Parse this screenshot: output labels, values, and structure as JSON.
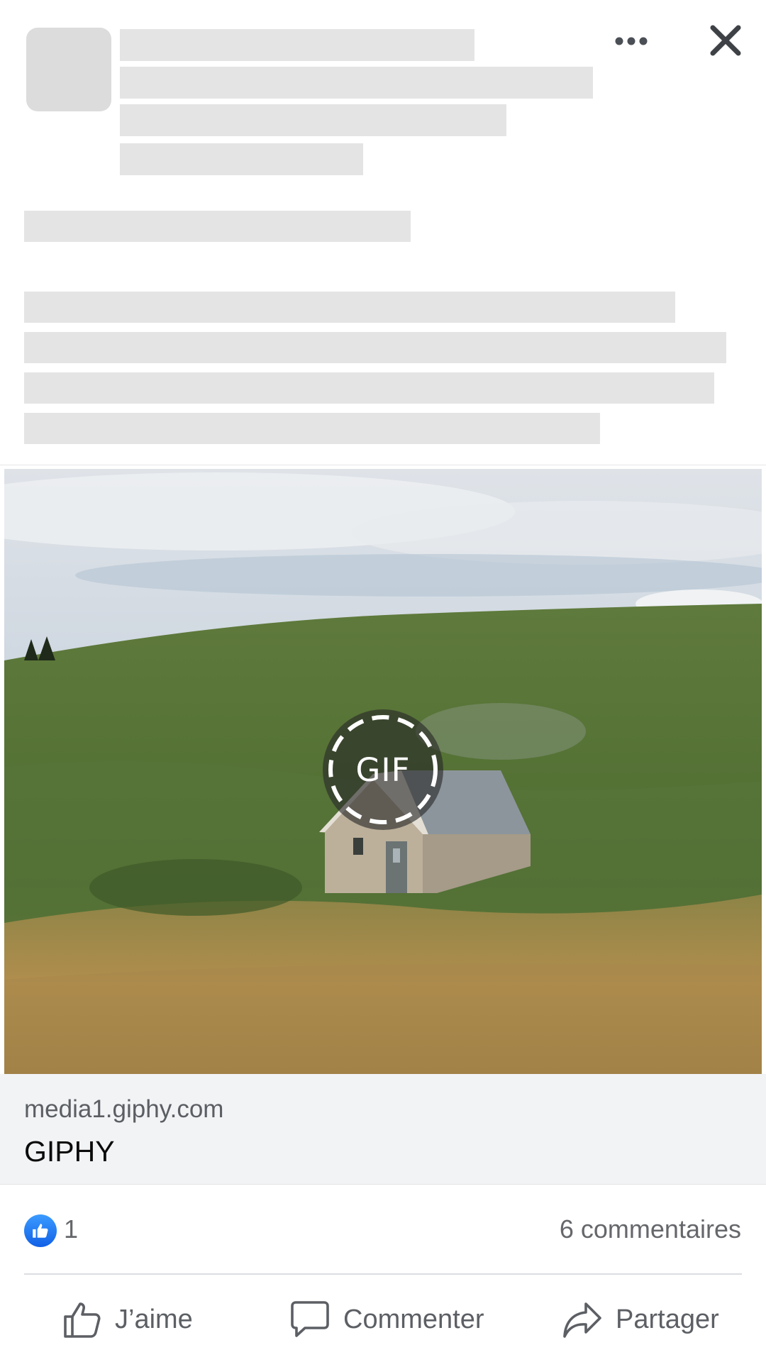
{
  "header": {
    "more_icon": "more-horizontal-icon",
    "close_icon": "close-icon"
  },
  "media": {
    "badge_label": "GIF",
    "badge_icon": "gif-play-icon"
  },
  "link_card": {
    "domain": "media1.giphy.com",
    "title": "GIPHY"
  },
  "reactions": {
    "like_icon": "thumbs-up-icon",
    "like_count": "1",
    "comments": "6 commentaires"
  },
  "actions": [
    {
      "label": "J’aime",
      "icon": "thumbs-up-outline-icon"
    },
    {
      "label": "Commenter",
      "icon": "comment-bubble-icon"
    },
    {
      "label": "Partager",
      "icon": "share-arrow-icon"
    }
  ],
  "colors": {
    "like_blue": "#1877f2",
    "skeleton": "#e4e4e4",
    "card_bg": "#f2f3f5",
    "muted_text": "#65676b"
  }
}
